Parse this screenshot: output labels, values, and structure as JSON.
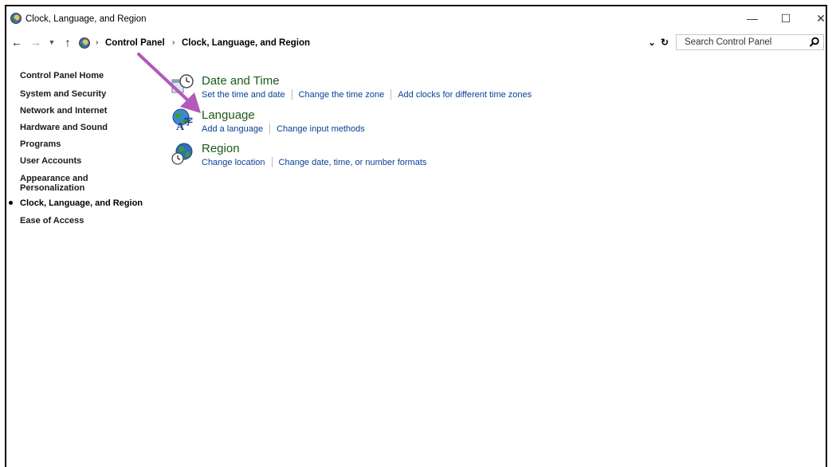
{
  "window": {
    "title": "Clock, Language, and Region",
    "controls": {
      "minimize": "—",
      "maximize": "☐",
      "close": "✕"
    }
  },
  "address_bar": {
    "breadcrumbs": [
      "Control Panel",
      "Clock, Language, and Region"
    ],
    "separator": "›",
    "search_placeholder": "Search Control Panel"
  },
  "sidebar": {
    "items": [
      {
        "label": "Control Panel Home"
      },
      {
        "label": "System and Security"
      },
      {
        "label": "Network and Internet"
      },
      {
        "label": "Hardware and Sound"
      },
      {
        "label": "Programs"
      },
      {
        "label": "User Accounts"
      },
      {
        "label": "Appearance and"
      },
      {
        "label": "Personalization"
      },
      {
        "label": "Clock, Language, and Region"
      },
      {
        "label": "Ease of Access"
      }
    ],
    "current_index": 8
  },
  "categories": [
    {
      "title": "Date and Time",
      "icon": "clock-icon",
      "links": [
        "Set the time and date",
        "Change the time zone",
        "Add clocks for different time zones"
      ]
    },
    {
      "title": "Language",
      "icon": "language-icon",
      "links": [
        "Add a language",
        "Change input methods"
      ]
    },
    {
      "title": "Region",
      "icon": "globe-clock-icon",
      "links": [
        "Change location",
        "Change date, time, or number formats"
      ]
    }
  ],
  "colors": {
    "link": "#0a3f96",
    "category_title": "#1a5a1a",
    "annotation_arrow": "#b35ab8"
  }
}
